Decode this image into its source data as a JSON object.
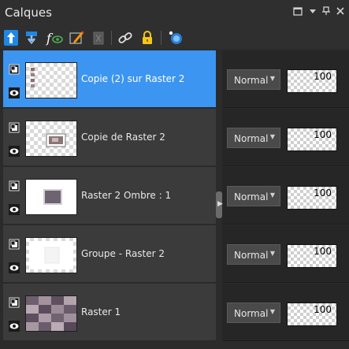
{
  "panel": {
    "title": "Calques",
    "controls": {
      "restore": "□",
      "menu": "▾",
      "pin": "⊥",
      "close": "×"
    }
  },
  "toolbar": {
    "icons": [
      "new-raster-layer-icon",
      "new-vector-layer-icon",
      "new-adjustment-layer-icon",
      "edit-layer-icon",
      "delete-layer-icon",
      "link-layers-icon",
      "lock-layer-icon",
      "layer-visibility-icon"
    ]
  },
  "layers": [
    {
      "name": "Copie (2) sur Raster 2",
      "blend": "Normal",
      "opacity": "100",
      "selected": true
    },
    {
      "name": "Copie de Raster 2",
      "blend": "Normal",
      "opacity": "100",
      "selected": false
    },
    {
      "name": "Raster 2 Ombre : 1",
      "blend": "Normal",
      "opacity": "100",
      "selected": false
    },
    {
      "name": "Groupe - Raster 2",
      "blend": "Normal",
      "opacity": "100",
      "selected": false
    },
    {
      "name": "Raster 1",
      "blend": "Normal",
      "opacity": "100",
      "selected": false
    }
  ],
  "colors": {
    "selection": "#3c95f0",
    "panel_bg": "#2b2b2b",
    "row_bg": "#3b3b3b"
  }
}
